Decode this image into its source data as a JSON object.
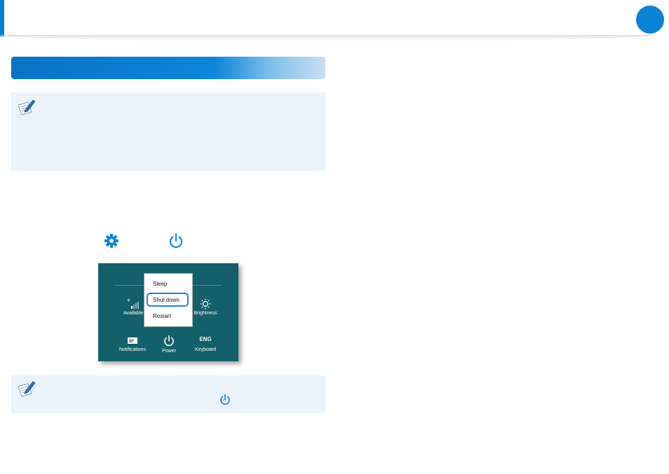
{
  "charm_panel": {
    "items": {
      "available": "Available",
      "brightness": "Brightness",
      "notifications": "Notifications",
      "power": "Power",
      "keyboard": "Keyboard",
      "keyboard_value": "ENG"
    },
    "power_menu": {
      "sleep": "Sleep",
      "shut_down": "Shut down",
      "restart": "Restart"
    }
  },
  "colors": {
    "accent": "#0a82d6",
    "note_background": "#eaf2fa",
    "charm_background": "#135f6b",
    "highlight": "#1a86d6"
  },
  "icons": [
    "note-pencil-icon",
    "gear-icon",
    "power-icon",
    "wifi-signal-icon",
    "brightness-icon",
    "notifications-icon"
  ]
}
